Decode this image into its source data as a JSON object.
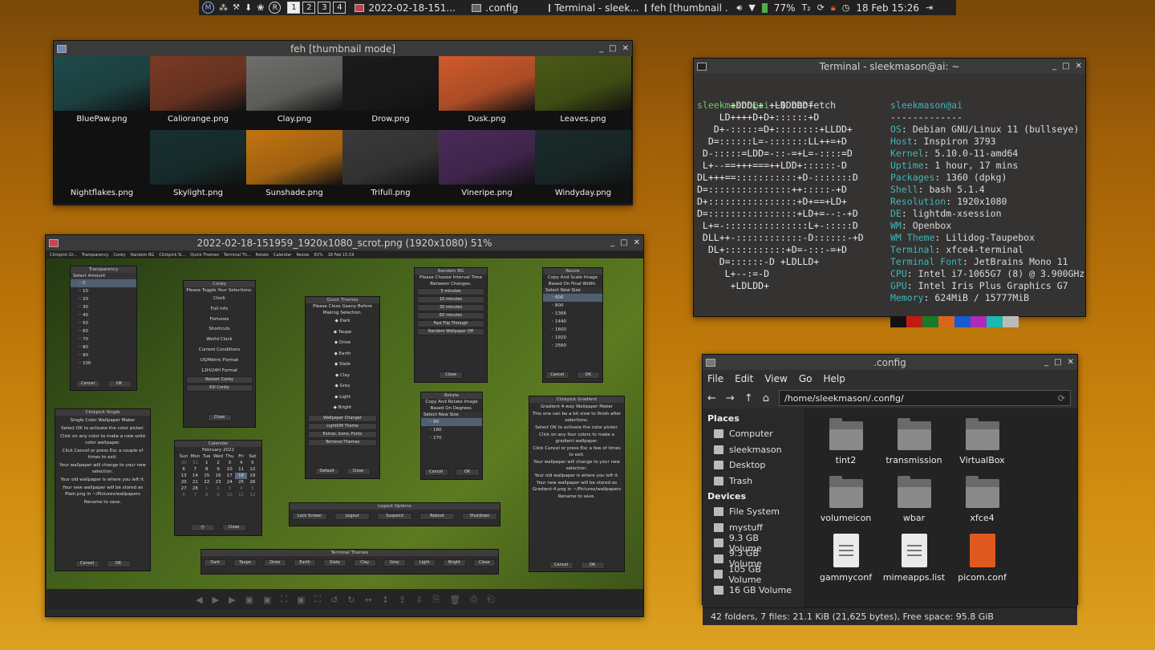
{
  "panel": {
    "ws_icons": [
      "M",
      "R"
    ],
    "workspaces": [
      "1",
      "2",
      "3",
      "4"
    ],
    "active_ws": 0,
    "tasks": [
      {
        "label": "2022-02-18-151..."
      },
      {
        "label": ".config"
      },
      {
        "label": "Terminal - sleek..."
      },
      {
        "label": "feh [thumbnail ..."
      }
    ],
    "battery": "77%",
    "clock": "18 Feb 15:26",
    "tray_icon": "T₂"
  },
  "feh": {
    "title": "feh [thumbnail mode]",
    "thumbs": [
      {
        "name": "BluePaw.png",
        "color": "#1e4a4a"
      },
      {
        "name": "Caliorange.png",
        "color": "#7a3a24"
      },
      {
        "name": "Clay.png",
        "color": "#6e6e6a"
      },
      {
        "name": "Drow.png",
        "color": "#1a1a1a"
      },
      {
        "name": "Dusk.png",
        "color": "#d05a2a"
      },
      {
        "name": "Leaves.png",
        "color": "#4a5a14"
      },
      {
        "name": "Nightflakes.png",
        "color": "#121212"
      },
      {
        "name": "Skylight.png",
        "color": "#183030"
      },
      {
        "name": "Sunshade.png",
        "color": "#c27410"
      },
      {
        "name": "Trifull.png",
        "color": "#3a3a3a"
      },
      {
        "name": "Vineripe.png",
        "color": "#4a2a5a"
      },
      {
        "name": "Windyday.png",
        "color": "#1a2a2a"
      }
    ]
  },
  "terminal": {
    "title": "Terminal - sleekmason@ai: ~",
    "prompt_user": "sleekmason@ai",
    "prompt_rest": ":~$ neofetch",
    "logo": [
      "      +DDDL+ +LDDDDD+",
      "    LD++++D+D+::::::+D",
      "   D+-:::::=D+::::::::+LLDD+",
      "  D=::::::L=-:::::::LL++=+D",
      " D-:::::=LDD=-::-=+L=-::::=D",
      " L+--==+++===++LDD+::::::-D",
      "DL+++==:::::::::::+D-:::::::D",
      "D=:::::::::::::::++:::::-+D",
      "D+::::::::::::::::+D+==+LD+",
      "D=::::::::::::::::+LD+=--:-+D",
      " L+=-:::::::::::::::L+-:::::D",
      " DLL++-::::::::::::-D::::::-+D",
      "  DL+:::::::::::+D=-:::-=+D",
      "    D=::::::-D +LDLLD+",
      "     L+--:=-D",
      "      +LDLDD+"
    ],
    "user": "sleekmason@ai",
    "sep": "-------------",
    "info": [
      [
        "OS",
        "Debian GNU/Linux 11 (bullseye)"
      ],
      [
        "Host",
        "Inspiron 3793"
      ],
      [
        "Kernel",
        "5.10.0-11-amd64"
      ],
      [
        "Uptime",
        "1 hour, 17 mins"
      ],
      [
        "Packages",
        "1360 (dpkg)"
      ],
      [
        "Shell",
        "bash 5.1.4"
      ],
      [
        "Resolution",
        "1920x1080"
      ],
      [
        "DE",
        "lightdm-xsession"
      ],
      [
        "WM",
        "Openbox"
      ],
      [
        "WM Theme",
        "Lilidog-Taupebox"
      ],
      [
        "Terminal",
        "xfce4-terminal"
      ],
      [
        "Terminal Font",
        "JetBrains Mono 11"
      ],
      [
        "CPU",
        "Intel i7-1065G7 (8) @ 3.900GHz"
      ],
      [
        "GPU",
        "Intel Iris Plus Graphics G7"
      ],
      [
        "Memory",
        "624MiB / 15777MiB"
      ]
    ],
    "palette": [
      "#111111",
      "#c01c10",
      "#1a7a2a",
      "#d8661a",
      "#1a5ad0",
      "#b02ab8",
      "#1ab8b0",
      "#bbbbbb"
    ]
  },
  "fm": {
    "title": ".config",
    "menu": [
      "File",
      "Edit",
      "View",
      "Go",
      "Help"
    ],
    "path": "/home/sleekmason/.config/",
    "places_h": "Places",
    "places": [
      "Computer",
      "sleekmason",
      "Desktop",
      "Trash"
    ],
    "devices_h": "Devices",
    "devices": [
      "File System",
      "mystuff",
      "9.3 GB Volume",
      "9.3 GB Volume",
      "105 GB Volume",
      "16 GB Volume"
    ],
    "items": [
      {
        "name": "tint2",
        "kind": "folder"
      },
      {
        "name": "transmission",
        "kind": "folder"
      },
      {
        "name": "VirtualBox",
        "kind": "folder"
      },
      {
        "name": "volumeicon",
        "kind": "folder"
      },
      {
        "name": "wbar",
        "kind": "folder"
      },
      {
        "name": "xfce4",
        "kind": "folder"
      },
      {
        "name": "gammyconf",
        "kind": "doc"
      },
      {
        "name": "mimeapps.list",
        "kind": "doc"
      },
      {
        "name": "picom.conf",
        "kind": "ubuntu"
      }
    ],
    "status": "42 folders, 7 files: 21.1 KiB (21,625 bytes), Free space: 95.8 GiB"
  },
  "viewer": {
    "title": "2022-02-18-151959_1920x1080_scrot.png (1920x1080) 51%",
    "mini_panel": [
      "Clickpick Gr...",
      "Transparency",
      "Conky",
      "Random BG",
      "Clickpick Si...",
      "Quick Themes",
      "Terminal Th...",
      "Rotate",
      "Calendar",
      "Resize",
      "81%",
      "18 Feb 15:19"
    ],
    "transparency": {
      "title": "Transparency",
      "cols": [
        "Select",
        "Amount"
      ],
      "rows": [
        "0",
        "10",
        "20",
        "30",
        "40",
        "50",
        "60",
        "70",
        "80",
        "90",
        "100"
      ],
      "cancel": "Cancel",
      "ok": "OK"
    },
    "conky": {
      "title": "Conky",
      "msg": "Please Toggle Your Selections.",
      "items": [
        "Clock",
        "Full info",
        "Fortunes",
        "Shortcuts",
        "World Clock",
        "Current Conditions",
        "US/Metric Format",
        "12H/24H Format"
      ],
      "btns": [
        "Restart Conky",
        "Kill Conky"
      ],
      "close": "Close"
    },
    "quick": {
      "title": "Quick Themes",
      "msg": "Please Close Geany Before Making Selection.",
      "items": [
        "Dark",
        "Taupe",
        "Drow",
        "Earth",
        "Slate",
        "Clay",
        "Grey",
        "Light",
        "Bright"
      ],
      "btns": [
        "Wallpaper Changer",
        "LightDM Theme",
        "Extras, Icons, Fonts",
        "Terminal Themes"
      ],
      "default": "Default",
      "close": "Close"
    },
    "randombg": {
      "title": "Random BG",
      "msg": "Please Choose Interval Time Between Changes.",
      "items": [
        "5 minutes",
        "10 minutes",
        "30 minutes",
        "60 minutes",
        "Fast Flip Through",
        "Random Wallpaper Off"
      ],
      "close": "Close"
    },
    "resize": {
      "title": "Resize",
      "msg": "Copy And Scale Image Based On Final Width.",
      "cols": [
        "Select",
        "New Size"
      ],
      "rows": [
        "600",
        "800",
        "1366",
        "1440",
        "1600",
        "1920",
        "2560"
      ],
      "cancel": "Cancel",
      "ok": "OK"
    },
    "rotate": {
      "title": "Rotate",
      "msg": "Copy And Rotate Image Based On Degrees.",
      "cols": [
        "Select",
        "New Size"
      ],
      "rows": [
        "90",
        "180",
        "270"
      ],
      "cancel": "Cancel",
      "ok": "OK"
    },
    "single": {
      "title": "Clickpick Single",
      "lines": [
        "Single Color Wallpaper Maker",
        "Select OK to activate the color picker.",
        "Click on any color to make a new solid color wallpaper.",
        "Click Cancel or press Esc a couple of times to exit.",
        "Your wallpaper will change to your new selection.",
        "Your old wallpaper is where you left it.",
        "Your new wallpaper will be stored as Plain.png in ~/Pictures/wallpapers",
        "Rename to save."
      ],
      "cancel": "Cancel",
      "ok": "OK"
    },
    "gradient": {
      "title": "Clickpick Gradient",
      "lines": [
        "Gradient 4-way Wallpaper Maker",
        "This one can be a bit slow to finish after selections.",
        "Select OK to activate the color picker.",
        "Click on any four colors to make a gradient wallpaper.",
        "Click Cancel or press Esc a few of times to exit.",
        "Your wallpaper will change to your new selection.",
        "Your old wallpaper is where you left it.",
        "Your new wallpaper will be stored as Gradient-4.png in ~/Pictures/wallpapers",
        "Rename to save."
      ],
      "cancel": "Cancel",
      "ok": "OK"
    },
    "calendar": {
      "title": "Calendar",
      "month": "February",
      "year": "2022",
      "days": [
        "Sun",
        "Mon",
        "Tue",
        "Wed",
        "Thu",
        "Fri",
        "Sat"
      ],
      "cells": [
        "30",
        "31",
        "1",
        "2",
        "3",
        "4",
        "5",
        "6",
        "7",
        "8",
        "9",
        "10",
        "11",
        "12",
        "13",
        "14",
        "15",
        "16",
        "17",
        "18",
        "19",
        "20",
        "21",
        "22",
        "23",
        "24",
        "25",
        "26",
        "27",
        "28",
        "1",
        "2",
        "3",
        "4",
        "5",
        "6",
        "7",
        "8",
        "9",
        "10",
        "11",
        "12"
      ],
      "today": "18",
      "close": "Close"
    },
    "logout": {
      "title": "Logout Options",
      "btns": [
        "Lock Screen",
        "Logout",
        "Suspend",
        "Reboot",
        "Shutdown"
      ]
    },
    "termthemes": {
      "title": "Terminal Themes",
      "btns": [
        "Dark",
        "Taupe",
        "Drow",
        "Earth",
        "Slate",
        "Clay",
        "Grey",
        "Light",
        "Bright",
        "Close"
      ]
    },
    "tools": [
      "◀",
      "▶",
      "▶",
      "▣",
      "▣",
      "⛶",
      "▣",
      "⛶",
      "↺",
      "↻",
      "↔",
      "↕",
      "⇪",
      "⇩",
      "⎘",
      "🗑",
      "⎙",
      "⎗"
    ]
  }
}
